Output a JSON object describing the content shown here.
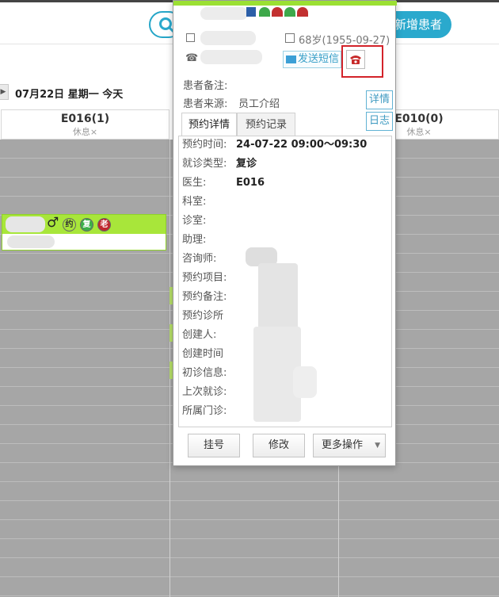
{
  "header": {
    "add_patient_label": "新增患者"
  },
  "date_bar": {
    "date_text": "07月22日 星期一 今天"
  },
  "columns": [
    {
      "title": "E016(1)",
      "status": "休息×"
    },
    {
      "title": "E010(0)",
      "status": "休息×"
    }
  ],
  "appointment": {
    "badges": [
      "约",
      "复",
      "老"
    ]
  },
  "popup": {
    "age": "68岁(1955-09-27)",
    "sms_label": "发送短信",
    "remark_label": "患者备注:",
    "source_label": "患者来源:",
    "source_value": "员工介绍",
    "detail_btn": "详情",
    "log_btn": "日志",
    "tabs": [
      "预约详情",
      "预约记录"
    ],
    "detail_rows": [
      {
        "label": "预约时间:",
        "value": "24-07-22 09:00～09:30"
      },
      {
        "label": "就诊类型:",
        "value": "复诊"
      },
      {
        "label": "医生:",
        "value": "E016"
      },
      {
        "label": "科室:",
        "value": ""
      },
      {
        "label": "诊室:",
        "value": ""
      },
      {
        "label": "助理:",
        "value": ""
      },
      {
        "label": "咨询师:",
        "value": ""
      },
      {
        "label": "预约项目:",
        "value": ""
      },
      {
        "label": "预约备注:",
        "value": ""
      },
      {
        "label": "预约诊所",
        "value": ""
      },
      {
        "label": "创建人:",
        "value": ""
      },
      {
        "label": "创建时间",
        "value": ""
      },
      {
        "label": "初诊信息:",
        "value": ""
      },
      {
        "label": "上次就诊:",
        "value": ""
      },
      {
        "label": "所属门诊:",
        "value": ""
      }
    ],
    "actions": {
      "register": "挂号",
      "modify": "修改",
      "more": "更多操作"
    }
  },
  "colors": {
    "accent": "#2aa9cd",
    "green": "#a8e63a",
    "highlight": "#d3232a",
    "grid": "#a6a6a6"
  }
}
